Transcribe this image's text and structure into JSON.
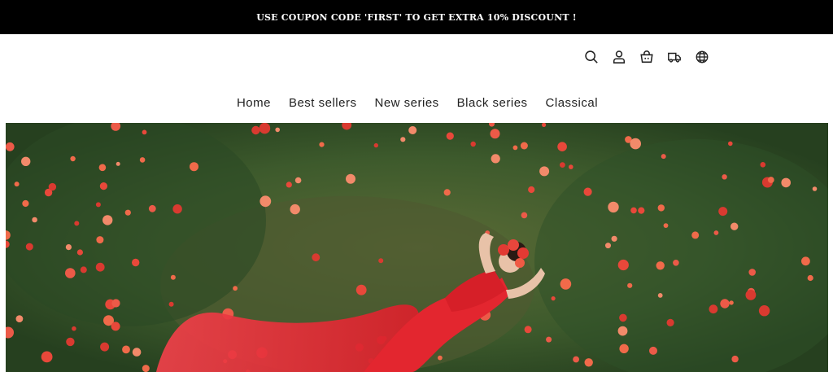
{
  "announcement": {
    "text": "USE COUPON CODE 'FIRST' TO GET EXTRA 10% DISCOUNT !"
  },
  "header": {
    "icons": [
      "search-icon",
      "account-icon",
      "cart-icon",
      "shipping-icon",
      "language-icon"
    ]
  },
  "nav": {
    "items": [
      {
        "label": "Home"
      },
      {
        "label": "Best sellers"
      },
      {
        "label": "New series"
      },
      {
        "label": "Black series"
      },
      {
        "label": "Classical"
      }
    ]
  },
  "colors": {
    "announce_bg": "#000000",
    "announce_text": "#ffffff",
    "nav_text": "#222222",
    "grass_dark": "#2f4a25",
    "grass_light": "#6f8f4a",
    "poppy": "#e8483a",
    "dress": "#e3262f"
  }
}
